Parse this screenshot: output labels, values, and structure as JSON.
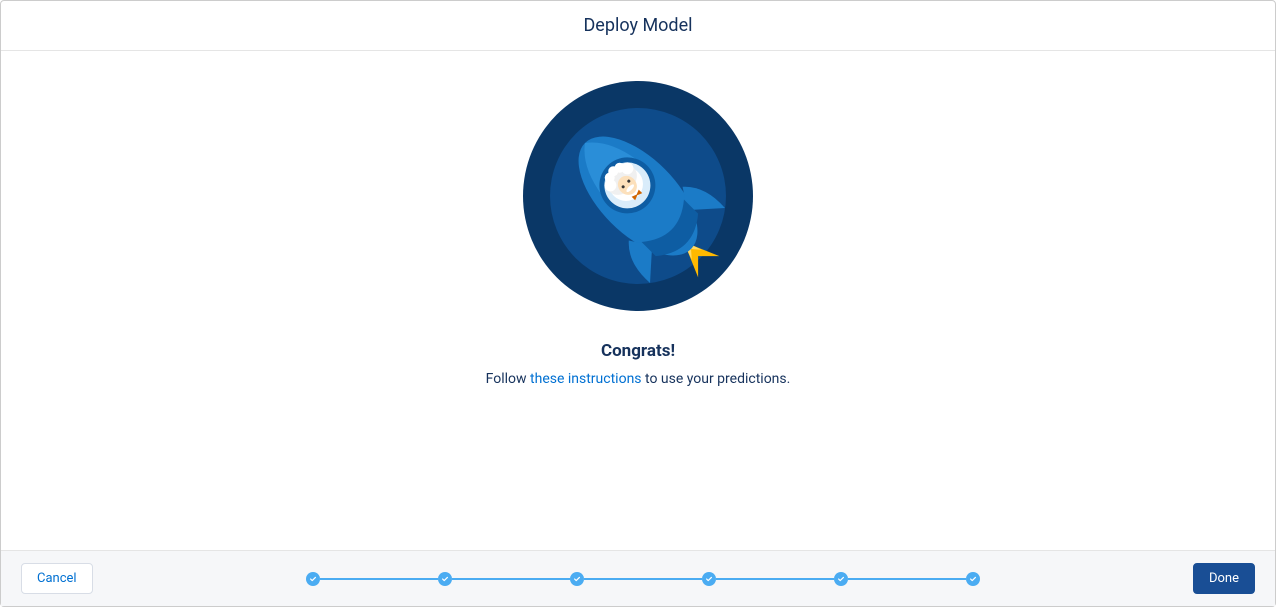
{
  "header": {
    "title": "Deploy Model"
  },
  "content": {
    "congrats_title": "Congrats!",
    "instruction_prefix": "Follow ",
    "instruction_link_text": "these instructions",
    "instruction_suffix": " to use your predictions."
  },
  "footer": {
    "cancel_label": "Cancel",
    "done_label": "Done"
  },
  "progress": {
    "total_steps": 6,
    "completed_steps": 6
  }
}
